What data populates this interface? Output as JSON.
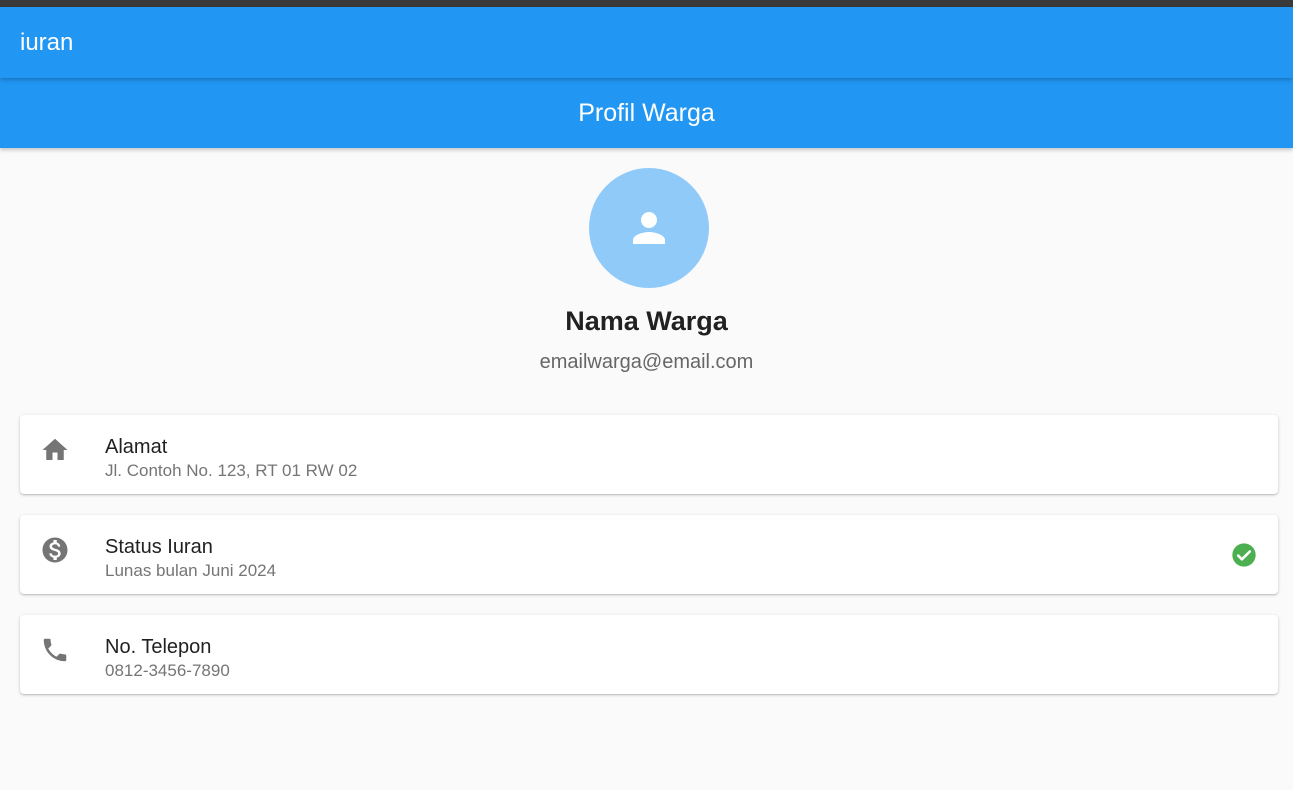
{
  "appbar": {
    "title": "iuran"
  },
  "header": {
    "title": "Profil Warga"
  },
  "profile": {
    "avatar_icon": "person-icon",
    "name": "Nama Warga",
    "email": "emailwarga@email.com"
  },
  "cards": [
    {
      "icon": "home-icon",
      "title": "Alamat",
      "subtitle": "Jl. Contoh No. 123, RT 01 RW 02"
    },
    {
      "icon": "dollar-circle-icon",
      "title": "Status Iuran",
      "subtitle": "Lunas bulan Juni 2024",
      "trailing_icon": "check-circle-icon",
      "trailing_color": "#4caf50"
    },
    {
      "icon": "phone-icon",
      "title": "No. Telepon",
      "subtitle": "0812-3456-7890"
    }
  ],
  "colors": {
    "primary": "#2196f3",
    "avatar_bg": "#90caf9",
    "success": "#4caf50"
  }
}
